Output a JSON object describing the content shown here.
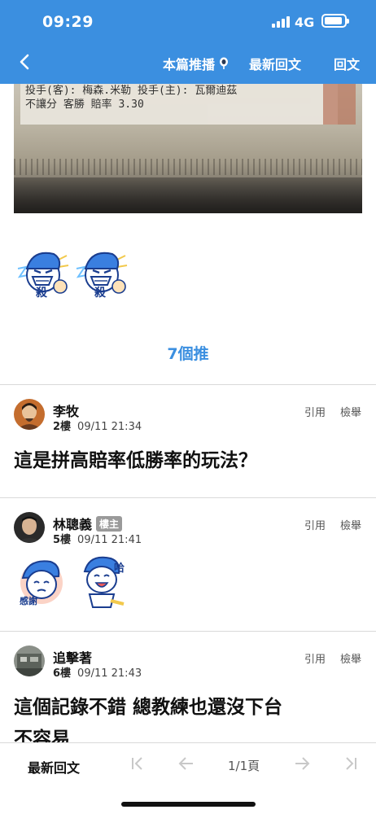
{
  "status_bar": {
    "time": "09:29",
    "network": "4G",
    "battery_level": 0.9
  },
  "nav": {
    "push_label": "本篇推播",
    "latest_label": "最新回文",
    "reply_label": "回文"
  },
  "photo": {
    "line1": "投手(客): 梅森.米勒  投手(主): 瓦爾迪茲",
    "line2": "不讓分  客勝  賠率   3.30"
  },
  "push_count": "7個推",
  "comments": [
    {
      "author": "李牧",
      "floor": "2樓",
      "time": "09/11 21:34",
      "quote": "引用",
      "report": "檢舉",
      "text": "這是拼高賠率低勝率的玩法？"
    },
    {
      "author": "林聰義",
      "badge": "樓主",
      "floor": "5樓",
      "time": "09/11 21:41",
      "quote": "引用",
      "report": "檢舉",
      "sticker1_text": "感謝",
      "sticker2_text": "哈"
    },
    {
      "author": "追擊著",
      "floor": "6樓",
      "time": "09/11 21:43",
      "quote": "引用",
      "report": "檢舉",
      "text_line1": "這個記錄不錯 總教練也還沒下台",
      "text_line2": "不容易"
    }
  ],
  "stickers_top": [
    {
      "text": "殺"
    },
    {
      "text": "殺"
    }
  ],
  "bottom_bar": {
    "latest_label": "最新回文",
    "page_label": "1/1頁"
  },
  "colors": {
    "accent": "#3b8fe0"
  }
}
